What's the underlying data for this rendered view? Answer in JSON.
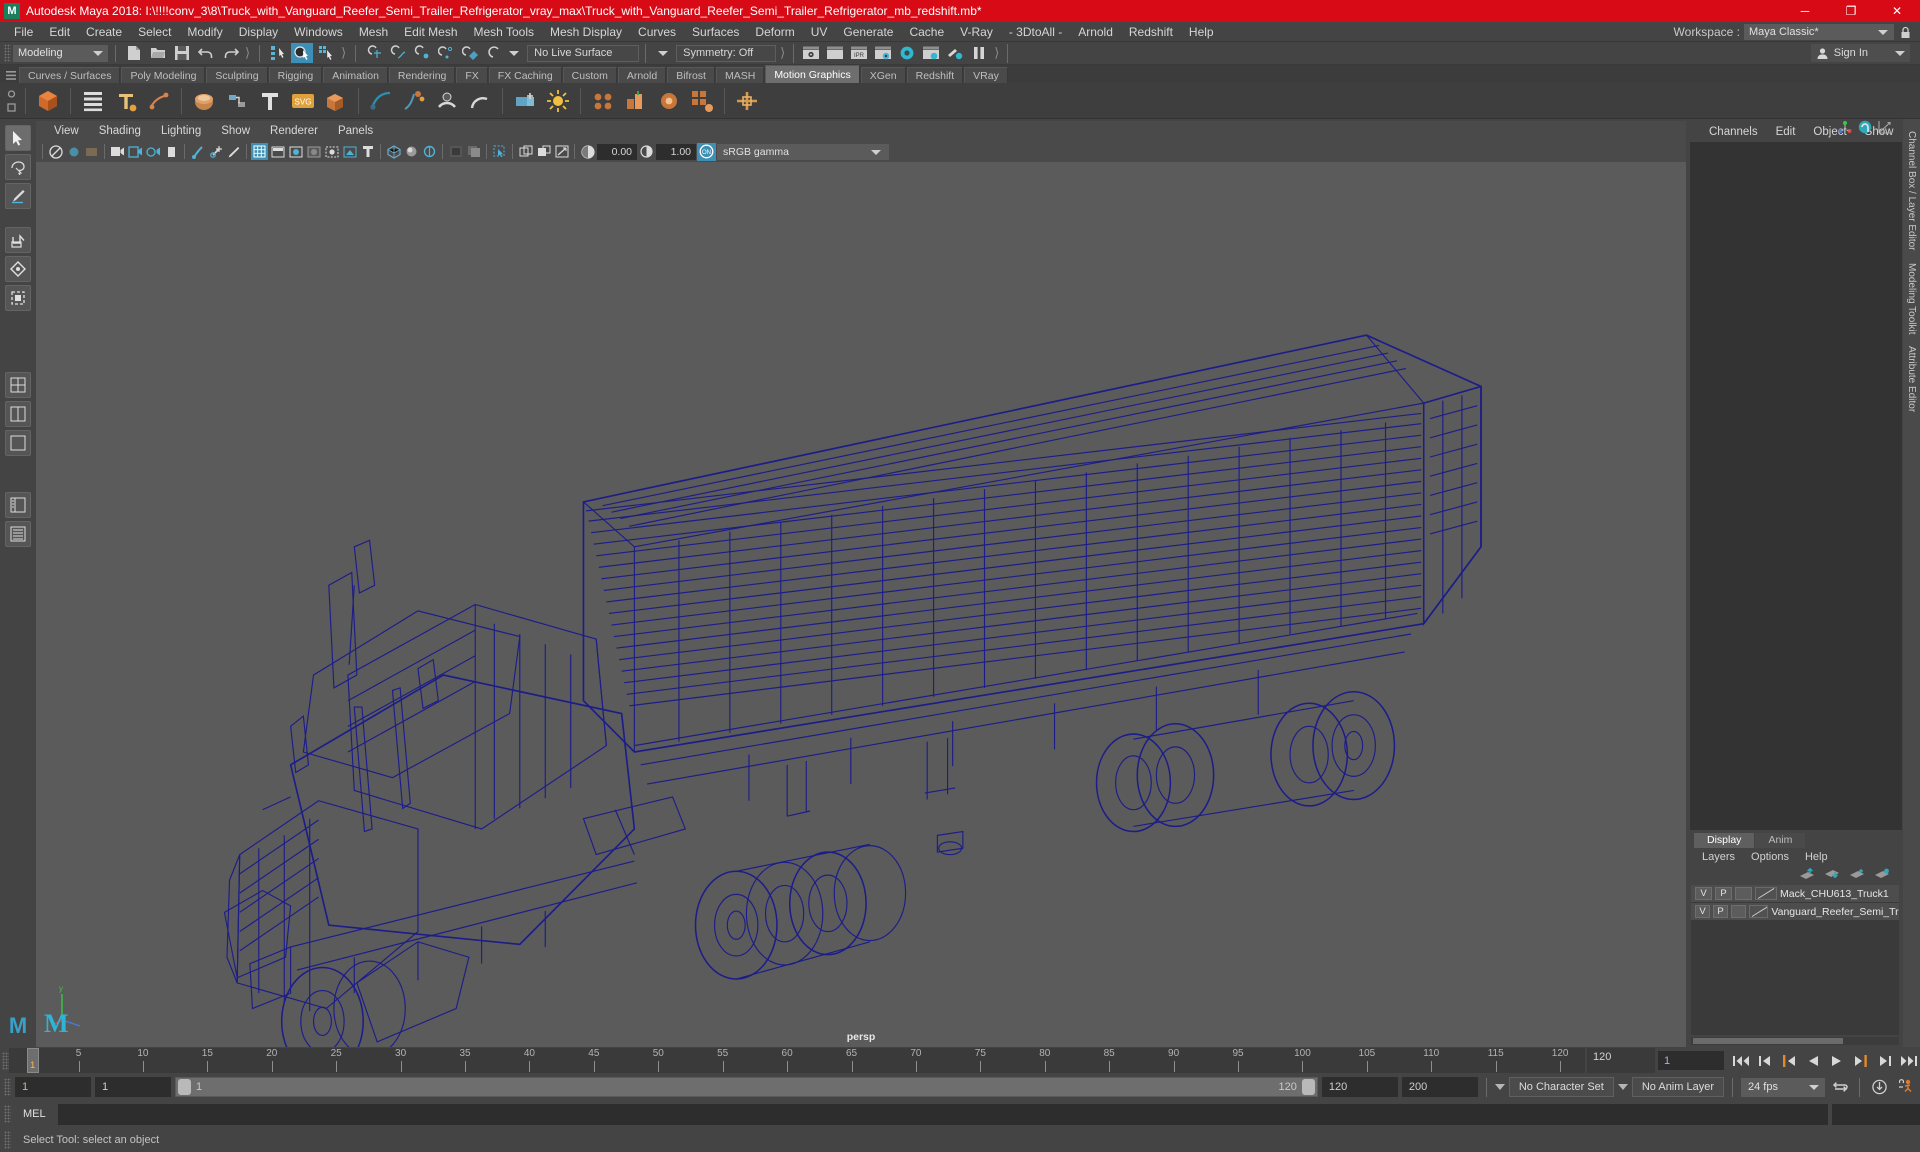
{
  "window": {
    "title": "Autodesk Maya 2018: I:\\!!!!conv_3\\8\\Truck_with_Vanguard_Reefer_Semi_Trailer_Refrigerator_vray_max\\Truck_with_Vanguard_Reefer_Semi_Trailer_Refrigerator_mb_redshift.mb*",
    "logo": "M",
    "minimize": "─",
    "maximize": "❐",
    "close": "✕",
    "titlebar_color": "#d80a16"
  },
  "menubar": {
    "items": [
      "File",
      "Edit",
      "Create",
      "Select",
      "Modify",
      "Display",
      "Windows",
      "Mesh",
      "Edit Mesh",
      "Mesh Tools",
      "Mesh Display",
      "Curves",
      "Surfaces",
      "Deform",
      "UV",
      "Generate",
      "Cache",
      "V-Ray",
      "- 3DtoAll -",
      "Arnold",
      "Redshift",
      "Help"
    ],
    "workspace_label": "Workspace :",
    "workspace_value": "Maya Classic*",
    "lock_icon": "lock-icon"
  },
  "statusbar": {
    "menuset": "Modeling",
    "live_surface": "No Live Surface",
    "symmetry": "Symmetry: Off",
    "signin": "Sign In",
    "icons": [
      "new-scene-icon",
      "open-scene-icon",
      "save-scene-icon",
      "undo-icon",
      "redo-icon",
      "select-hierarchy-icon",
      "select-object-icon",
      "select-component-icon",
      "snap-grid-icon",
      "snap-curve-icon",
      "snap-point-icon",
      "snap-projected-center-icon",
      "snap-view-plane-icon",
      "make-live-icon",
      "render-view-icon",
      "render-current-frame-icon",
      "ipr-render-icon",
      "render-settings-icon",
      "hypershade-icon",
      "render-sequence-icon",
      "render-setup-icon",
      "pause-render-icon"
    ]
  },
  "shelf": {
    "tabs": [
      "Curves / Surfaces",
      "Poly Modeling",
      "Sculpting",
      "Rigging",
      "Animation",
      "Rendering",
      "FX",
      "FX Caching",
      "Custom",
      "Arnold",
      "Bifrost",
      "MASH",
      "Motion Graphics",
      "XGen",
      "Redshift",
      "VRay"
    ],
    "active_tab": "Motion Graphics",
    "icons": [
      "mash-network-icon",
      "mash-outliner-icon",
      "mash-text-icon",
      "mash-trail-icon",
      "mash-dynamics-icon",
      "mash-merge-icon",
      "type-tool-icon",
      "svg-tool-icon",
      "extrude-icon",
      "motion-trail-icon",
      "paint-effects-icon",
      "sweep-mesh-icon",
      "arc-icon",
      "bevel-plus-icon",
      "light-icon",
      "mash-waiter-icon",
      "mash-repro-icon",
      "mash-influence-icon",
      "mash-instancer-icon",
      "mash-constraint-icon"
    ]
  },
  "toolbox": {
    "items": [
      "select-tool",
      "lasso-select-tool",
      "paint-select-tool",
      "move-tool",
      "rotate-tool",
      "scale-tool",
      "last-tool",
      "four-view-layout",
      "two-pane-layout",
      "single-pane-layout",
      "outliner-persp-layout",
      "hypergraph-layout"
    ],
    "logo": "M"
  },
  "viewport": {
    "menus": [
      "View",
      "Shading",
      "Lighting",
      "Show",
      "Renderer",
      "Panels"
    ],
    "exposure_value": "0.00",
    "gamma_value": "1.00",
    "color_profile": "sRGB gamma",
    "camera_label": "persp",
    "background_color": "#5b5b5b",
    "wireframe_color": "#1a1a8c",
    "toolbar_icons": [
      "select-camera-icon",
      "lock-camera-icon",
      "camera-attributes-icon",
      "bookmarks-icon",
      "image-plane-icon",
      "2d-pan-zoom-icon",
      "grid-toggle-icon",
      "film-gate-icon",
      "resolution-gate-icon",
      "gate-mask-icon",
      "xray-icon",
      "xray-joints-icon",
      "texture-icon",
      "wireframe-icon",
      "smooth-shade-icon",
      "smooth-shade-all-icon",
      "shaded-textured-icon",
      "use-default-light-icon",
      "shadows-icon",
      "ao-icon",
      "motion-blur-icon",
      "multisample-icon",
      "depth-peeling-icon",
      "exposure-icon",
      "gamma-icon",
      "color-management-icon"
    ]
  },
  "channel_box": {
    "tabs": [
      "Channels",
      "Edit",
      "Object",
      "Show"
    ],
    "side_tabs": [
      "Channel Box / Layer Editor",
      "Modeling Toolkit",
      "Attribute Editor"
    ],
    "header_icons": [
      "show-manipulator-icon",
      "attribute-editor-icon",
      "graph-editor-icon"
    ]
  },
  "layer_editor": {
    "tabs": [
      "Display",
      "Anim"
    ],
    "active_tab": "Display",
    "menus": [
      "Layers",
      "Options",
      "Help"
    ],
    "buttons": [
      "move-layer-up-icon",
      "move-layer-down-icon",
      "new-layer-icon",
      "new-layer-from-selected-icon"
    ],
    "columns": [
      "V",
      "P",
      ""
    ],
    "layers": [
      {
        "visible": "V",
        "playback": "P",
        "state": "",
        "name": "Mack_CHU613_Truck1"
      },
      {
        "visible": "V",
        "playback": "P",
        "state": "",
        "name": "Vanguard_Reefer_Semi_Trailer"
      }
    ]
  },
  "timeslider": {
    "tick_labels": [
      "5",
      "10",
      "15",
      "20",
      "25",
      "30",
      "35",
      "40",
      "45",
      "50",
      "55",
      "60",
      "65",
      "70",
      "75",
      "80",
      "85",
      "90",
      "95",
      "100",
      "105",
      "110",
      "115",
      "120"
    ],
    "current_frame_marker": "1",
    "end_display": "120",
    "current_frame_field": "1",
    "playback_buttons": [
      "go-to-start-icon",
      "step-back-keyframe-icon",
      "step-back-frame-icon",
      "play-backwards-icon",
      "play-forwards-icon",
      "step-forward-frame-icon",
      "step-forward-keyframe-icon",
      "go-to-end-icon"
    ]
  },
  "range": {
    "anim_start": "1",
    "range_start": "1",
    "slider_start_label": "1",
    "slider_end_label": "120",
    "range_end": "120",
    "anim_end": "200",
    "character_set": "No Character Set",
    "anim_layer": "No Anim Layer",
    "fps": "24 fps",
    "icons": [
      "auto-key-icon",
      "animation-preferences-icon",
      "cycle-icon"
    ]
  },
  "command_line": {
    "language_label": "MEL",
    "input_value": "",
    "placeholder": ""
  },
  "status_line": {
    "message": "Select Tool: select an object"
  }
}
